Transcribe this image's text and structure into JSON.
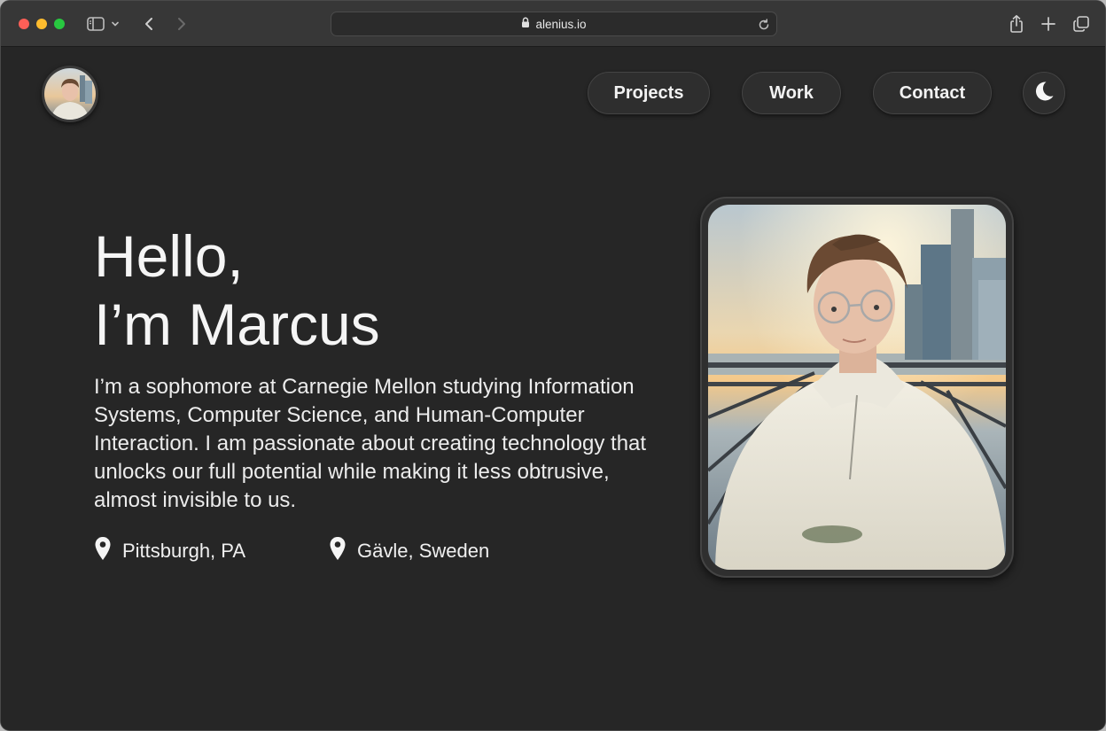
{
  "browser": {
    "url": "alenius.io",
    "icons": [
      "sidebar-icon",
      "chevron-down-icon",
      "back-icon",
      "forward-icon",
      "lock-icon",
      "reload-icon",
      "share-icon",
      "new-tab-icon",
      "tabs-overview-icon"
    ]
  },
  "nav": {
    "items": [
      {
        "label": "Projects"
      },
      {
        "label": "Work"
      },
      {
        "label": "Contact"
      }
    ],
    "theme_toggle_icon": "moon-icon"
  },
  "hero": {
    "line1": "Hello,",
    "line2": "I’m Marcus",
    "bio": "I’m a sophomore at Carnegie Mellon studying Information Systems, Computer Science, and Human-Computer Interaction. I am passionate about creating technology that unlocks our full potential while making it less obtrusive, almost invisible to us.",
    "locations": [
      {
        "label": "Pittsburgh, PA",
        "icon": "map-pin-icon"
      },
      {
        "label": "Gävle, Sweden",
        "icon": "map-pin-icon"
      }
    ]
  },
  "colors": {
    "page_background": "#262626",
    "toolbar": "#373737",
    "button_background": "#2e2e2e",
    "text": "#f5f5f5"
  }
}
